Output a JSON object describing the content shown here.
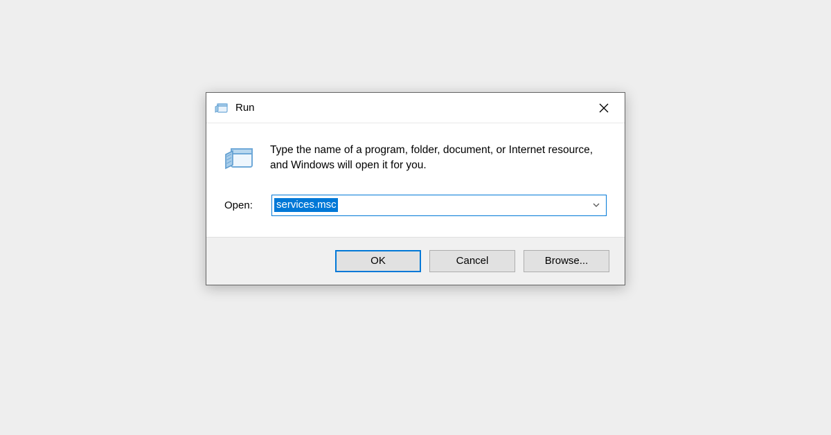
{
  "window": {
    "title": "Run",
    "close_label": "Close"
  },
  "body": {
    "instruction": "Type the name of a program, folder, document, or Internet resource, and Windows will open it for you.",
    "open_label": "Open:",
    "open_value": "services.msc"
  },
  "buttons": {
    "ok": "OK",
    "cancel": "Cancel",
    "browse": "Browse..."
  },
  "icons": {
    "run_small": "run-icon",
    "run_large": "run-icon",
    "close": "close-icon",
    "dropdown": "chevron-down-icon"
  }
}
